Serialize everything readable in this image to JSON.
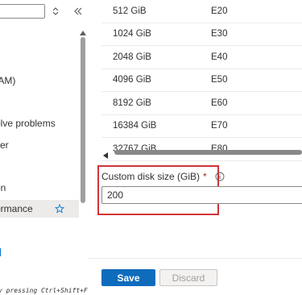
{
  "nav": {
    "filter_value": "",
    "items": [
      {
        "label": "IAM)",
        "selected": false
      },
      {
        "label": "olve problems",
        "selected": false
      },
      {
        "label": "zer",
        "selected": false
      },
      {
        "label": "on",
        "selected": false
      },
      {
        "label": "ormance",
        "selected": true
      }
    ],
    "shortcut_hint": "y pressing Ctrl+Shift+F"
  },
  "tiers": {
    "rows": [
      {
        "size": "512 GiB",
        "tier": "E20"
      },
      {
        "size": "1024 GiB",
        "tier": "E30"
      },
      {
        "size": "2048 GiB",
        "tier": "E40"
      },
      {
        "size": "4096 GiB",
        "tier": "E50"
      },
      {
        "size": "8192 GiB",
        "tier": "E60"
      },
      {
        "size": "16384 GiB",
        "tier": "E70"
      },
      {
        "size": "32767 GiB",
        "tier": "E80"
      }
    ]
  },
  "custom_size": {
    "label": "Custom disk size (GiB)",
    "required_mark": "*",
    "value": "200"
  },
  "actions": {
    "save_label": "Save",
    "discard_label": "Discard"
  },
  "colors": {
    "accent": "#0f6cbd",
    "highlight": "#d13438",
    "required": "#a4262c"
  }
}
